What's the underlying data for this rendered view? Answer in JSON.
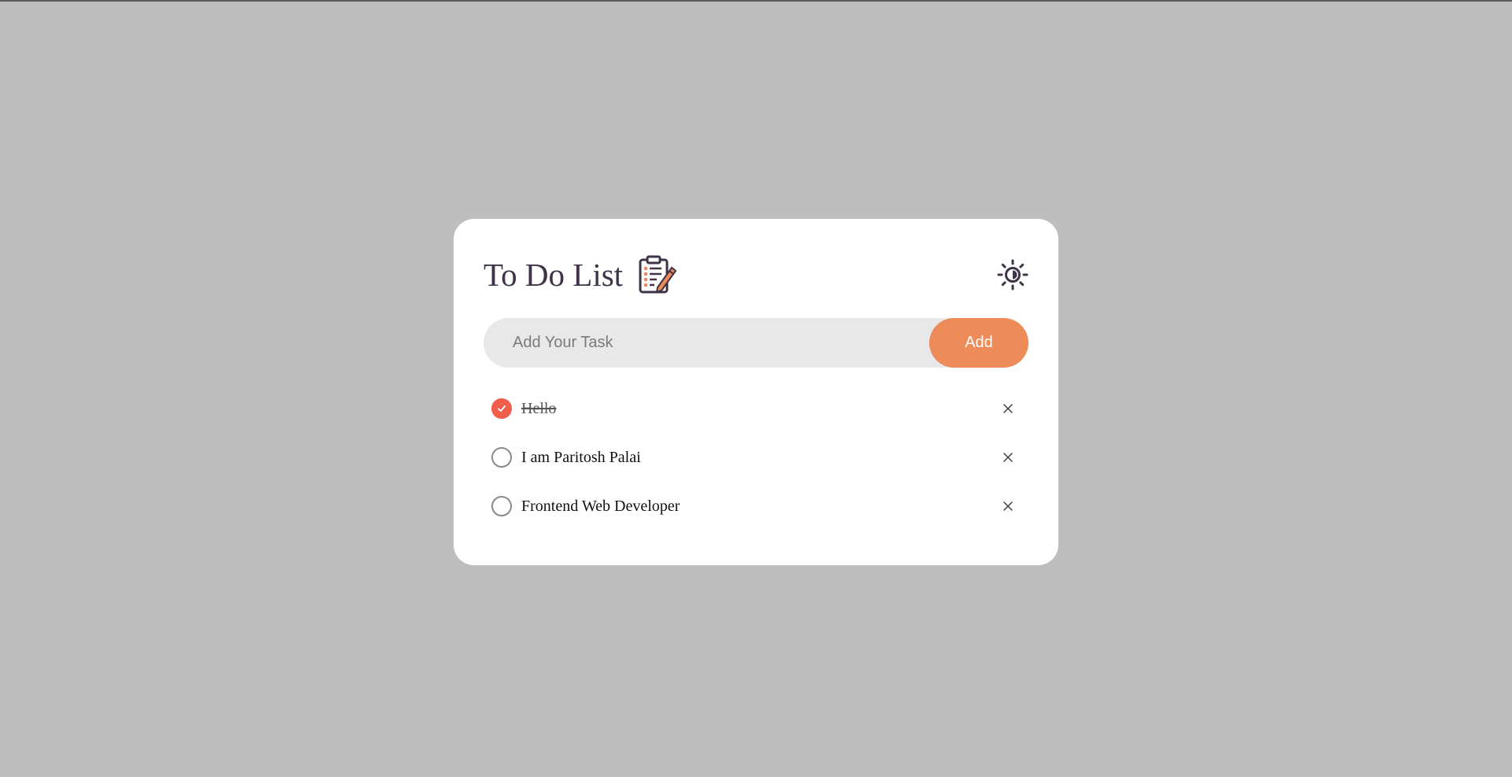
{
  "app": {
    "title": "To Do List",
    "title_icon": "clipboard-pencil-icon",
    "theme_toggle_icon": "sun-icon"
  },
  "input": {
    "placeholder": "Add Your Task",
    "value": ""
  },
  "add_button": {
    "label": "Add"
  },
  "tasks": [
    {
      "text": "Hello",
      "completed": true
    },
    {
      "text": "I am Paritosh Palai",
      "completed": false
    },
    {
      "text": "Frontend Web Developer",
      "completed": false
    }
  ],
  "colors": {
    "accent": "#ed8b59",
    "checked": "#ee5e4a",
    "title": "#3f3348",
    "background": "#bebebe"
  }
}
